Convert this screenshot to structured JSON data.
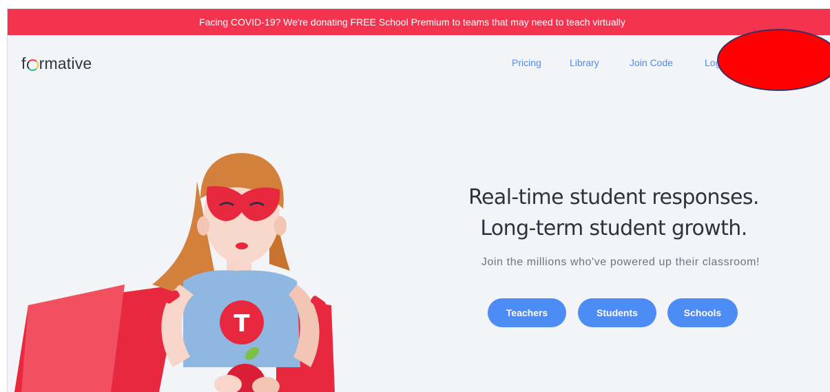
{
  "banner": {
    "text": "Facing COVID-19? We're donating FREE School Premium to teams that may need to teach virtually"
  },
  "header": {
    "logo_prefix": "f",
    "logo_suffix": "rmative",
    "nav": [
      "Pricing",
      "Library",
      "Join Code",
      "Log"
    ]
  },
  "hero": {
    "title_line1": "Real-time student responses.",
    "title_line2": "Long-term student growth.",
    "subtitle": "Join the millions who've powered up their classroom!",
    "buttons": [
      "Teachers",
      "Students",
      "Schools"
    ],
    "badge_letter": "T"
  },
  "colors": {
    "banner": "#f4334f",
    "accent": "#4d8cf5",
    "background": "#f3f4f7",
    "text": "#2c333d"
  }
}
